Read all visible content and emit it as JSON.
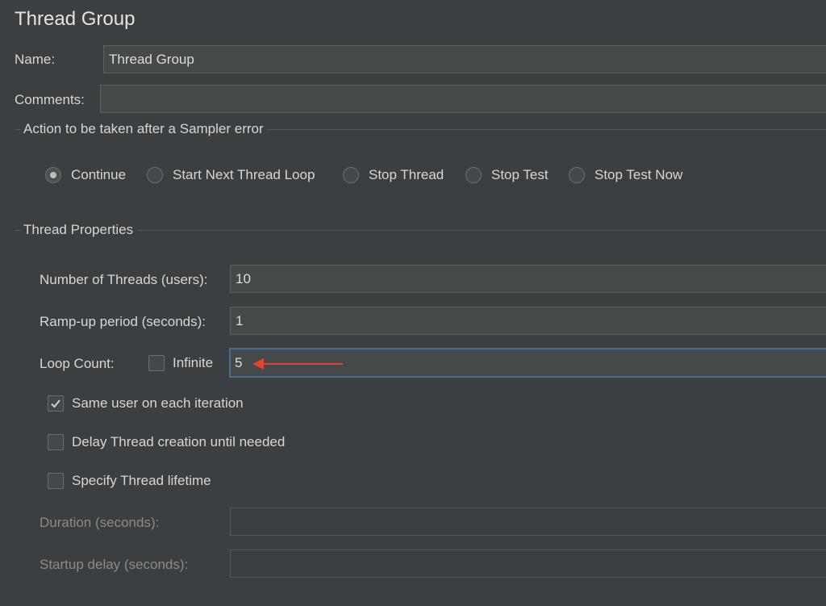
{
  "panel": {
    "title": "Thread Group"
  },
  "name_field": {
    "label": "Name:",
    "value": "Thread Group"
  },
  "comments_field": {
    "label": "Comments:",
    "value": ""
  },
  "sampler_error": {
    "section_title": "Action to be taken after a Sampler error",
    "options": [
      {
        "label": "Continue",
        "selected": true
      },
      {
        "label": "Start Next Thread Loop",
        "selected": false
      },
      {
        "label": "Stop Thread",
        "selected": false
      },
      {
        "label": "Stop Test",
        "selected": false
      },
      {
        "label": "Stop Test Now",
        "selected": false
      }
    ]
  },
  "thread_properties": {
    "section_title": "Thread Properties",
    "num_threads": {
      "label": "Number of Threads (users):",
      "value": "10"
    },
    "ramp_up": {
      "label": "Ramp-up period (seconds):",
      "value": "1"
    },
    "loop_count": {
      "label": "Loop Count:",
      "infinite_label": "Infinite",
      "infinite_checked": false,
      "value": "5"
    },
    "same_user": {
      "label": "Same user on each iteration",
      "checked": true
    },
    "delay_thread": {
      "label": "Delay Thread creation until needed",
      "checked": false
    },
    "specify_lifetime": {
      "label": "Specify Thread lifetime",
      "checked": false
    },
    "duration": {
      "label": "Duration (seconds):",
      "value": ""
    },
    "startup_delay": {
      "label": "Startup delay (seconds):",
      "value": ""
    }
  },
  "annotation": {
    "arrow_color": "#e2452f"
  },
  "icons": {
    "checkmark": "checkmark-icon",
    "arrow": "arrow-left-icon"
  }
}
